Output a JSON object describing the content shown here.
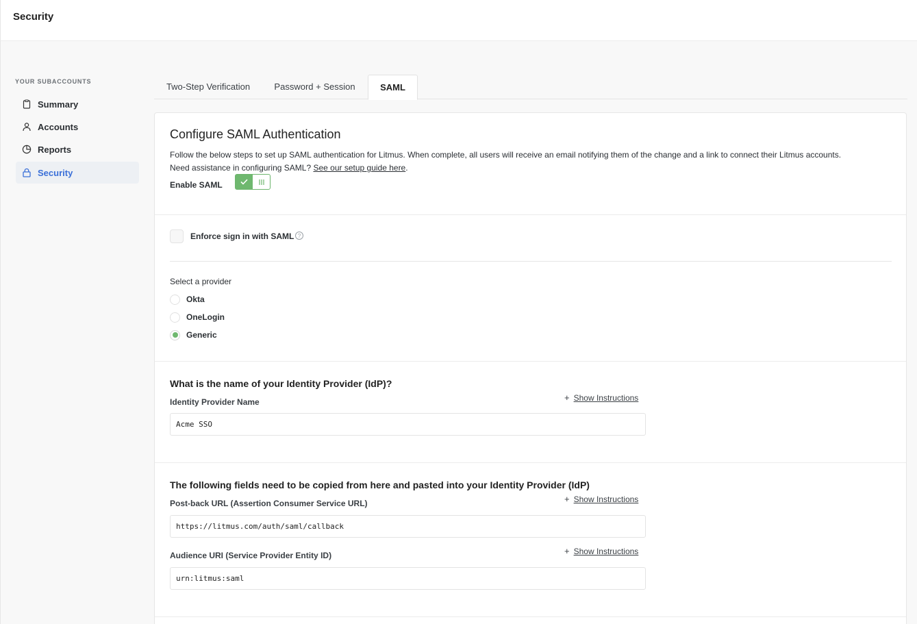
{
  "header": {
    "title": "Security"
  },
  "sidebar": {
    "heading": "YOUR SUBACCOUNTS",
    "items": [
      {
        "label": "Summary",
        "icon": "clipboard-icon",
        "active": false
      },
      {
        "label": "Accounts",
        "icon": "user-icon",
        "active": false
      },
      {
        "label": "Reports",
        "icon": "pie-chart-icon",
        "active": false
      },
      {
        "label": "Security",
        "icon": "lock-icon",
        "active": true
      }
    ]
  },
  "tabs": [
    {
      "label": "Two-Step Verification",
      "active": false
    },
    {
      "label": "Password + Session",
      "active": false
    },
    {
      "label": "SAML",
      "active": true
    }
  ],
  "saml": {
    "title": "Configure SAML Authentication",
    "description": "Follow the below steps to set up SAML authentication for Litmus. When complete, all users will receive an email notifying them of the change and a link to connect their Litmus accounts.",
    "assist_text": "Need assistance in configuring SAML?",
    "guide_link": "See our setup guide here",
    "guide_suffix": ".",
    "enable_label": "Enable SAML",
    "enabled": true,
    "enforce_label": "Enforce sign in with SAML",
    "enforce_checked": false,
    "provider_label": "Select a provider",
    "providers": [
      {
        "label": "Okta",
        "selected": false
      },
      {
        "label": "OneLogin",
        "selected": false
      },
      {
        "label": "Generic",
        "selected": true
      }
    ],
    "idp_question": "What is the name of your Identity Provider (IdP)?",
    "idp_name_label": "Identity Provider Name",
    "idp_name_value": "Acme SSO",
    "show_instructions": "Show Instructions",
    "copy_title": "The following fields need to be copied from here and pasted into your Identity Provider (IdP)",
    "postback_label": "Post-back URL (Assertion Consumer Service URL)",
    "postback_value": "https://litmus.com/auth/saml/callback",
    "audience_label": "Audience URI (Service Provider Entity ID)",
    "audience_value": "urn:litmus:saml"
  },
  "colors": {
    "accent_blue": "#3a6fd8",
    "toggle_green": "#6fb86f"
  }
}
